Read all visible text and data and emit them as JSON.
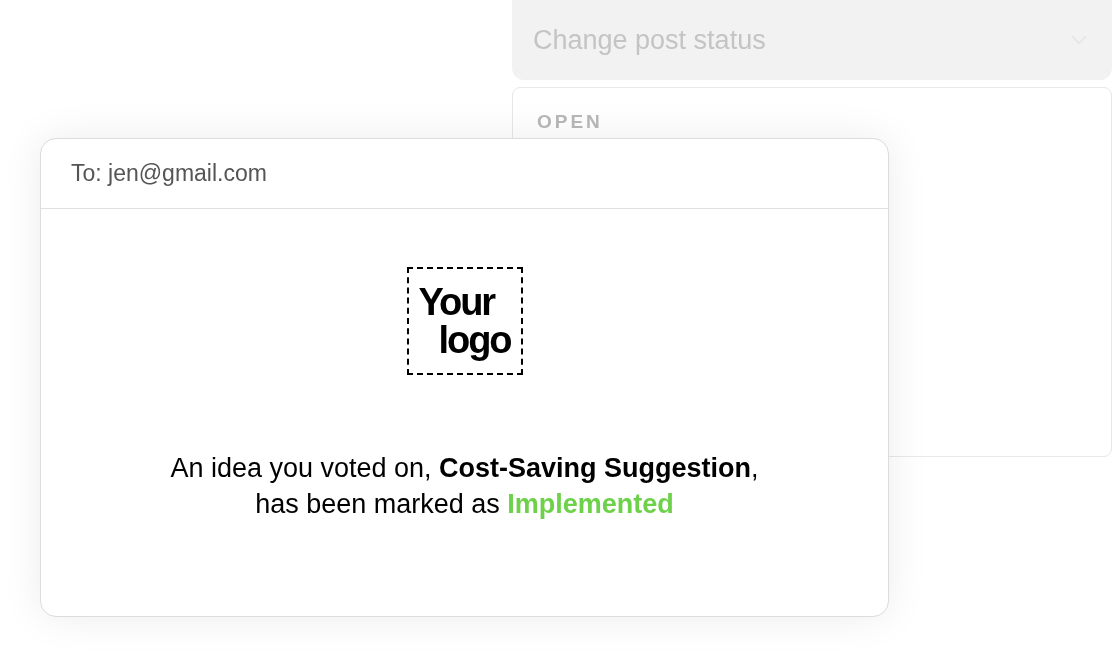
{
  "status_select": {
    "placeholder": "Change post status"
  },
  "status_list": {
    "heading": "OPEN"
  },
  "email": {
    "to": "To: jen@gmail.com",
    "logo_lines": [
      "Your",
      "logo"
    ],
    "message_line_1": "An idea you voted on, **Cost-Saving Suggestion**,",
    "message_line_2": "has been marked as",
    "status": "Implemented"
  }
}
